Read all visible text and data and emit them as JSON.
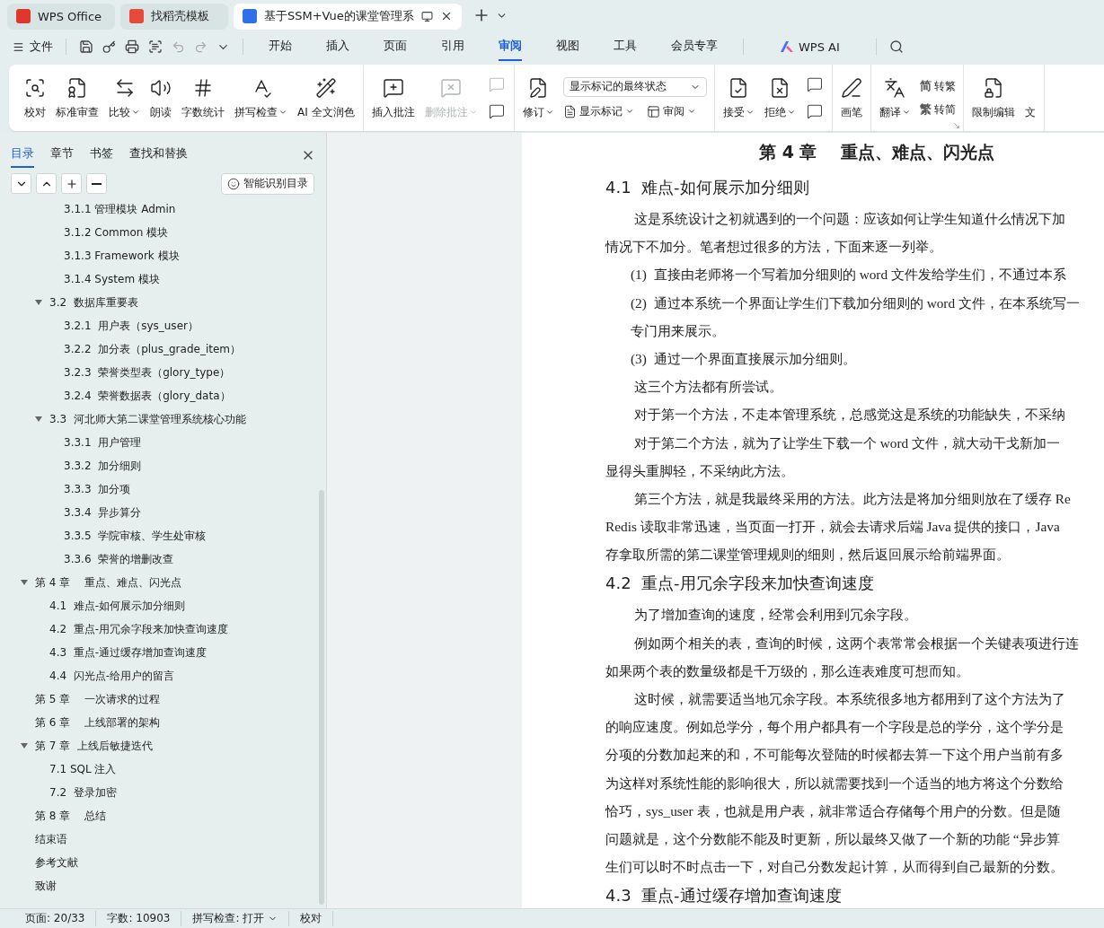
{
  "title_tabs": [
    {
      "label": "WPS Office",
      "selected": false
    },
    {
      "label": "找稻壳模板",
      "selected": false
    },
    {
      "label": "基于SSM+Vue的课堂管理系",
      "selected": true
    }
  ],
  "menu": {
    "file": "文件",
    "tabs": [
      {
        "label": "开始",
        "selected": false
      },
      {
        "label": "插入",
        "selected": false
      },
      {
        "label": "页面",
        "selected": false
      },
      {
        "label": "引用",
        "selected": false
      },
      {
        "label": "审阅",
        "selected": true
      },
      {
        "label": "视图",
        "selected": false
      },
      {
        "label": "工具",
        "selected": false
      },
      {
        "label": "会员专享",
        "selected": false
      }
    ],
    "ai": "WPS AI"
  },
  "ribbon": [
    {
      "items": [
        {
          "kind": "large",
          "label": "校对",
          "dropdown": false,
          "disabled": false
        },
        {
          "kind": "large",
          "label": "标准审查",
          "dropdown": false,
          "disabled": false
        },
        {
          "kind": "large",
          "label": "比较",
          "dropdown": true,
          "disabled": false
        },
        {
          "kind": "large",
          "label": "朗读",
          "dropdown": false,
          "disabled": false
        },
        {
          "kind": "large",
          "label": "字数统计",
          "dropdown": false,
          "disabled": false
        },
        {
          "kind": "large",
          "label": "拼写检查",
          "dropdown": true,
          "disabled": false
        },
        {
          "kind": "large",
          "label": "AI 全文润色",
          "dropdown": false,
          "disabled": false
        }
      ]
    },
    {
      "items": [
        {
          "kind": "large",
          "label": "插入批注",
          "dropdown": false,
          "disabled": false
        },
        {
          "kind": "large",
          "label": "删除批注",
          "dropdown": true,
          "disabled": true
        },
        {
          "kind": "stack",
          "items": [
            {
              "disabled": true
            },
            {
              "disabled": false
            }
          ]
        }
      ]
    },
    {
      "items": [
        {
          "kind": "large",
          "label": "修订",
          "dropdown": true,
          "disabled": false
        },
        {
          "kind": "select-stack",
          "select": "显示标记的最终状态",
          "items": [
            {
              "label": "显示标记",
              "dropdown": true
            },
            {
              "label": "审阅",
              "dropdown": true
            }
          ]
        }
      ]
    },
    {
      "items": [
        {
          "kind": "large",
          "label": "接受",
          "dropdown": true,
          "disabled": false
        },
        {
          "kind": "large",
          "label": "拒绝",
          "dropdown": true,
          "disabled": false
        },
        {
          "kind": "stack",
          "items": [
            {
              "disabled": false
            },
            {
              "disabled": false
            }
          ]
        }
      ]
    },
    {
      "items": [
        {
          "kind": "large",
          "label": "画笔",
          "dropdown": false,
          "disabled": false
        }
      ]
    },
    {
      "items": [
        {
          "kind": "large",
          "label": "翻译",
          "dropdown": true,
          "disabled": false
        },
        {
          "kind": "glyph-stack",
          "items": [
            {
              "glyph": "简",
              "label": "转繁"
            },
            {
              "glyph": "繁",
              "label": "转简"
            }
          ]
        }
      ]
    },
    {
      "items": [
        {
          "kind": "large",
          "label": "限制编辑",
          "dropdown": false,
          "disabled": false
        },
        {
          "kind": "large",
          "label": "文",
          "dropdown": false,
          "disabled": false,
          "partial": true
        }
      ]
    }
  ],
  "sidebar": {
    "tabs": [
      {
        "label": "目录",
        "selected": true
      },
      {
        "label": "章节",
        "selected": false
      },
      {
        "label": "书签",
        "selected": false
      },
      {
        "label": "查找和替换",
        "selected": false
      }
    ],
    "smart_button": "智能识别目录",
    "toc": [
      {
        "children": [
          {
            "children": [
              {
                "label": "3.1.1 管理模块 Admin"
              },
              {
                "label": "3.1.2 Common 模块"
              },
              {
                "label": "3.1.3 Framework 模块"
              },
              {
                "label": "3.1.4 System 模块"
              }
            ]
          },
          {
            "label": "3.2  数据库重要表",
            "expanded": true,
            "children": [
              {
                "label": "3.2.1  用户表（sys_user）"
              },
              {
                "label": "3.2.2  加分表（plus_grade_item）"
              },
              {
                "label": "3.2.3  荣誉类型表（glory_type）"
              },
              {
                "label": "3.2.4  荣誉数据表（glory_data）"
              }
            ]
          },
          {
            "label": "3.3  河北师大第二课堂管理系统核心功能",
            "expanded": true,
            "children": [
              {
                "label": "3.3.1  用户管理"
              },
              {
                "label": "3.3.2  加分细则"
              },
              {
                "label": "3.3.3  加分项"
              },
              {
                "label": "3.3.4  异步算分"
              },
              {
                "label": "3.3.5  学院审核、学生处审核"
              },
              {
                "label": "3.3.6  荣誉的增删改查"
              }
            ]
          }
        ]
      },
      {
        "label": "第 4 章    重点、难点、闪光点",
        "expanded": true,
        "children": [
          {
            "label": "4.1  难点-如何展示加分细则"
          },
          {
            "label": "4.2  重点-用冗余字段来加快查询速度"
          },
          {
            "label": "4.3  重点-通过缓存增加查询速度"
          },
          {
            "label": "4.4  闪光点-给用户的留言"
          }
        ]
      },
      {
        "label": "第 5 章    一次请求的过程"
      },
      {
        "label": "第 6 章    上线部署的架构"
      },
      {
        "label": "第 7 章  上线后敏捷迭代",
        "expanded": true,
        "children": [
          {
            "label": "7.1 SQL 注入"
          },
          {
            "label": "7.2  登录加密"
          }
        ]
      },
      {
        "label": "第 8 章    总结"
      },
      {
        "label": "结束语"
      },
      {
        "label": "参考文献"
      },
      {
        "label": "致谢"
      }
    ]
  },
  "document": [
    {
      "kind": "chapter",
      "text": "第 4 章    重点、难点、闪光点"
    },
    {
      "kind": "heading",
      "text": "4.1  难点-如何展示加分细则"
    },
    {
      "kind": "first",
      "text": "这是系统设计之初就遇到的一个问题：应该如何让学生知道什么情况下加"
    },
    {
      "kind": "plain",
      "text": "情况下不加分。笔者想过很多的方法，下面来逐一列举。"
    },
    {
      "kind": "item",
      "marker": "(1)",
      "text": "直接由老师将一个写着加分细则的 word 文件发给学生们，不通过本系"
    },
    {
      "kind": "item",
      "marker": "(2)",
      "text": "通过本系统一个界面让学生们下载加分细则的 word 文件，在本系统写一"
    },
    {
      "kind": "cont",
      "text": "专门用来展示。"
    },
    {
      "kind": "item",
      "marker": "(3)",
      "text": "通过一个界面直接展示加分细则。"
    },
    {
      "kind": "first",
      "text": "这三个方法都有所尝试。"
    },
    {
      "kind": "first",
      "text": "对于第一个方法，不走本管理系统，总感觉这是系统的功能缺失，不采纳"
    },
    {
      "kind": "first",
      "text": "对于第二个方法，就为了让学生下载一个 word 文件，就大动干戈新加一"
    },
    {
      "kind": "plain",
      "text": "显得头重脚轻，不采纳此方法。"
    },
    {
      "kind": "first",
      "text": "第三个方法，就是我最终采用的方法。此方法是将加分细则放在了缓存 Re"
    },
    {
      "kind": "plain",
      "text": "Redis 读取非常迅速，当页面一打开，就会去请求后端 Java 提供的接口，Java"
    },
    {
      "kind": "plain",
      "text": "存拿取所需的第二课堂管理规则的细则，然后返回展示给前端界面。"
    },
    {
      "kind": "heading",
      "text": "4.2  重点-用冗余字段来加快查询速度"
    },
    {
      "kind": "first",
      "text": "为了增加查询的速度，经常会利用到冗余字段。"
    },
    {
      "kind": "first",
      "text": "例如两个相关的表，查询的时候，这两个表常常会根据一个关键表项进行连"
    },
    {
      "kind": "plain",
      "text": "如果两个表的数量级都是千万级的，那么连表难度可想而知。"
    },
    {
      "kind": "first",
      "text": "这时候，就需要适当地冗余字段。本系统很多地方都用到了这个方法为了"
    },
    {
      "kind": "plain",
      "text": "的响应速度。例如总学分，每个用户都具有一个字段是总的学分，这个学分是"
    },
    {
      "kind": "plain",
      "text": "分项的分数加起来的和，不可能每次登陆的时候都去算一下这个用户当前有多"
    },
    {
      "kind": "plain",
      "text": "为这样对系统性能的影响很大，所以就需要找到一个适当的地方将这个分数给"
    },
    {
      "kind": "plain",
      "text": "恰巧，sys_user 表，也就是用户表，就非常适合存储每个用户的分数。但是随"
    },
    {
      "kind": "plain",
      "text": "问题就是，这个分数能不能及时更新，所以最终又做了一个新的功能 “异步算"
    },
    {
      "kind": "plain",
      "text": "生们可以时不时点击一下，对自己分数发起计算，从而得到自己最新的分数。"
    },
    {
      "kind": "heading",
      "text": "4.3  重点-通过缓存增加查询速度"
    }
  ],
  "status_bar": [
    {
      "text": "页面: 20/33",
      "dropdown": false
    },
    {
      "text": "字数: 10903",
      "dropdown": false
    },
    {
      "text": "拼写检查: 打开",
      "dropdown": true
    },
    {
      "text": "校对",
      "dropdown": false
    }
  ]
}
